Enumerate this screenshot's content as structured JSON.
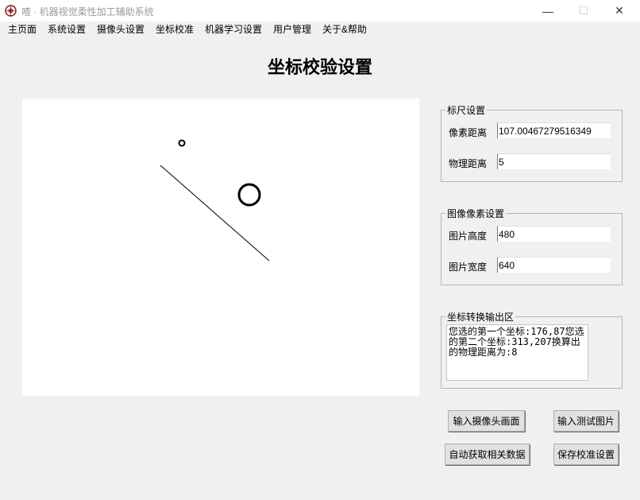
{
  "window": {
    "title": "喳 · 机器视觉柔性加工辅助系统",
    "controls": {
      "minimize": "—",
      "maximize": "☐",
      "close": "✕"
    }
  },
  "menu": [
    "主页面",
    "系统设置",
    "摄像头设置",
    "坐标校准",
    "机器学习设置",
    "用户管理",
    "关于&帮助"
  ],
  "page_title": "坐标校验设置",
  "scale_group": {
    "title": "标尺设置",
    "pixel_distance_label": "像素距离",
    "pixel_distance_value": "107.00467279516349",
    "physical_distance_label": "物理距离",
    "physical_distance_value": "5"
  },
  "image_group": {
    "title": "图像像素设置",
    "height_label": "图片高度",
    "height_value": "480",
    "width_label": "图片宽度",
    "width_value": "640"
  },
  "output_group": {
    "title": "坐标转换输出区",
    "text": "您选的第一个坐标:176,87您选的第二个坐标:313,207换算出的物理距离为:8"
  },
  "buttons": {
    "camera_input": "输入摄像头画面",
    "test_image_input": "输入测试图片",
    "auto_fetch": "自动获取相关数据",
    "save_calibration": "保存校准设置"
  }
}
